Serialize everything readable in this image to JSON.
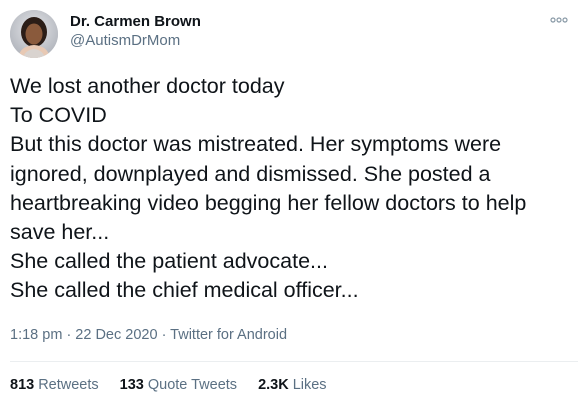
{
  "author": {
    "display_name": "Dr. Carmen Brown",
    "handle": "@AutismDrMom",
    "avatar_icon": "profile-photo"
  },
  "more_icon": "more-options-icon",
  "tweet": {
    "lines": [
      "We lost another doctor today",
      "To COVID",
      "But this doctor was mistreated. Her symptoms were",
      "ignored, downplayed and dismissed. She posted a",
      "heartbreaking video begging her fellow doctors to help",
      "save her...",
      "She called the patient advocate...",
      "She called the chief medical officer..."
    ]
  },
  "meta": {
    "time": "1:18 pm",
    "separator": "·",
    "date": "22 Dec 2020",
    "source": "Twitter for Android"
  },
  "stats": {
    "retweets_count": "813",
    "retweets_label": "Retweets",
    "quotes_count": "133",
    "quotes_label": "Quote Tweets",
    "likes_count": "2.3K",
    "likes_label": "Likes"
  },
  "colors": {
    "text": "#0f1419",
    "secondary": "#5b7083",
    "divider": "#ebeef0"
  }
}
